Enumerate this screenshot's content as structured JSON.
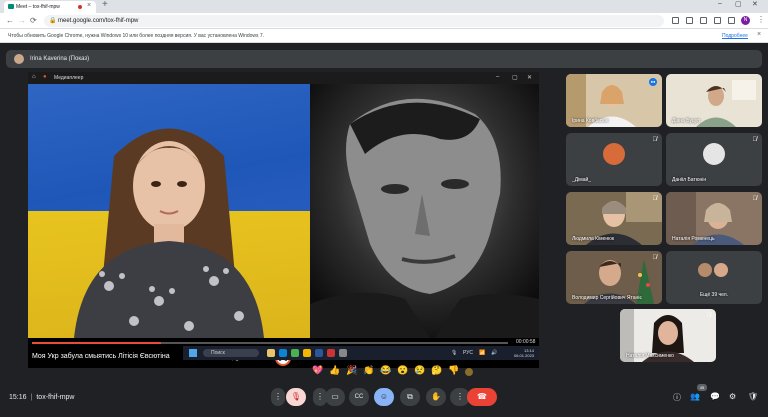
{
  "browser": {
    "tab_title": "Meet – tox-fhif-mpw",
    "tab_close": "×",
    "new_tab": "+",
    "url": "meet.google.com/tox-fhif-mpw",
    "profile_initial": "N",
    "window_controls": [
      "–",
      "▢",
      "✕"
    ],
    "nav": [
      "←",
      "→",
      "⟳"
    ]
  },
  "infobar": {
    "message": "Чтобы обновить Google Chrome, нужна Windows 10 или более поздняя версия. У вас установлена Windows 7.",
    "link": "Подробнее",
    "close": "×"
  },
  "presenter": {
    "name": "Irina Kaverina (Показ)"
  },
  "shared_screen": {
    "player_title": "Медиаплеер",
    "video_title": "Моя Укр забула смыятись Літісія Євсютіна",
    "progress": 0.27,
    "time": "00:00:58",
    "taskbar_search": "Поиск",
    "taskbar_lang": "РУС",
    "taskbar_time": "13:14",
    "taskbar_date": "06.01.2023"
  },
  "participants": [
    {
      "name": "Ірина Ковбасюк",
      "muted": false
    },
    {
      "name": "Діана Буцул",
      "muted": true
    },
    {
      "name": "_Дімай_",
      "muted": true
    },
    {
      "name": "Данііл Батюнін",
      "muted": true
    },
    {
      "name": "Людмила Кіменюк",
      "muted": true
    },
    {
      "name": "Наталія Роменець",
      "muted": true
    },
    {
      "name": "Володимир Сергійович Ятаніє",
      "muted": true
    },
    {
      "name": "Ещё 39 чел.",
      "muted": false
    },
    {
      "name": "Наталія Максименко",
      "muted": true
    }
  ],
  "reactions": [
    "💖",
    "👍",
    "🎉",
    "👏",
    "😂",
    "😮",
    "😢",
    "🤔",
    "👎"
  ],
  "bottom_bar": {
    "time": "15:16",
    "separator": "|",
    "meeting_code": "tox-fhif-mpw",
    "people_count": "45"
  },
  "icons": {
    "more": "⋮",
    "mic_off": "🎙",
    "camera": "▭",
    "captions": "CC",
    "react": "☺",
    "present": "⧉",
    "raise_hand": "✋",
    "hangup": "☎",
    "info": "ⓘ",
    "people": "👥",
    "chat": "💬",
    "activities": "⚙",
    "shield": "🛡"
  },
  "colors": {
    "meet_bg": "#202124",
    "tile_bg": "#3c4043",
    "hangup": "#ea4335",
    "accent": "#8ab4f8",
    "flag_blue": "#1f57b8",
    "flag_yellow": "#e8c41f"
  }
}
